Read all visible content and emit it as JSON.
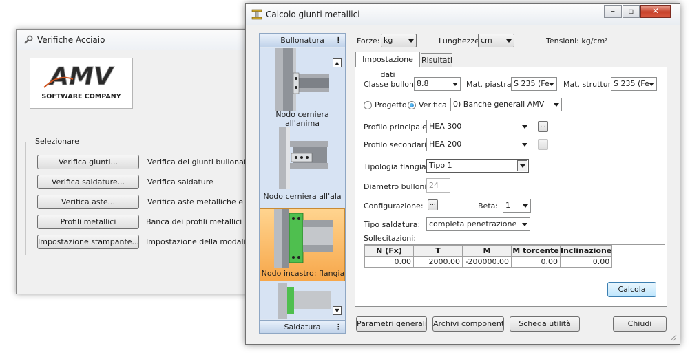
{
  "back_window": {
    "title": "Verifiche Acciaio",
    "logo": {
      "brand": "AMV",
      "tagline": "SOFTWARE COMPANY"
    },
    "group_label": "Selezionare",
    "rows": [
      {
        "button": "Verifica giunti...",
        "desc": "Verifica dei giunti bullonati e saldati"
      },
      {
        "button": "Verifica saldature...",
        "desc": "Verifica saldature"
      },
      {
        "button": "Verifica aste...",
        "desc": "Verifica aste metalliche e legno"
      },
      {
        "button": "Profili metallici",
        "desc": "Banca dei profili metallici"
      },
      {
        "button": "Impostazione stampante...",
        "desc": "Impostazione della modalità di stampa"
      }
    ]
  },
  "front_window": {
    "title": "Calcolo giunti metallici",
    "caption_buttons": {
      "minimize": "–",
      "maximize": "▫",
      "close": "✕"
    },
    "outlook_bar": {
      "top_header": "Bullonatura",
      "bottom_header": "Saldatura",
      "items": [
        {
          "label": "Nodo cerniera all'anima",
          "selected": false
        },
        {
          "label": "Nodo cerniera all'ala",
          "selected": false
        },
        {
          "label": "Nodo incastro: flangia",
          "selected": true
        }
      ]
    },
    "units": {
      "forze_label": "Forze:",
      "forze_value": "kg",
      "lunghezze_label": "Lunghezze:",
      "lunghezze_value": "cm",
      "tensioni": "Tensioni: kg/cm²"
    },
    "tabs": [
      {
        "label": "Impostazione dati",
        "active": true
      },
      {
        "label": "Risultati",
        "active": false
      }
    ],
    "form": {
      "classe_bullone_label": "Classe bullone:",
      "classe_bullone_value": "8.8",
      "mat_piastra_label": "Mat. piastra:",
      "mat_piastra_value": "S 235 (Fe",
      "mat_struttura_label": "Mat. struttura:",
      "mat_struttura_value": "S 235 (Fe",
      "progetto_label": "Progetto",
      "verifica_label": "Verifica",
      "mode": "Verifica",
      "banca_value": "0) Banche generali AMV",
      "profilo_principale_label": "Profilo principale:",
      "profilo_principale_value": "HEA 300",
      "profilo_secondario_label": "Profilo secondario:",
      "profilo_secondario_value": "HEA 200",
      "tipologia_label": "Tipologia flangia:",
      "tipologia_value": "Tipo 1",
      "diametro_label": "Diametro bulloni:",
      "diametro_value": "24",
      "configurazione_label": "Configurazione:",
      "ellipsis": "...",
      "beta_label": "Beta:",
      "beta_value": "1",
      "tipo_saldatura_label": "Tipo saldatura:",
      "tipo_saldatura_value": "completa penetrazione",
      "sollecitazioni_label": "Sollecitazioni:"
    },
    "grid": {
      "headers": [
        "N (Fx)",
        "T",
        "M",
        "M torcente",
        "Inclinazione"
      ],
      "row": [
        "0.00",
        "2000.00",
        "-200000.00",
        "0.00",
        "0.00"
      ]
    },
    "calcola_label": "Calcola",
    "footer": {
      "parametri": "Parametri generali...",
      "archivi": "Archivi componenti...",
      "scheda": "Scheda utilità",
      "chiudi": "Chiudi"
    }
  }
}
